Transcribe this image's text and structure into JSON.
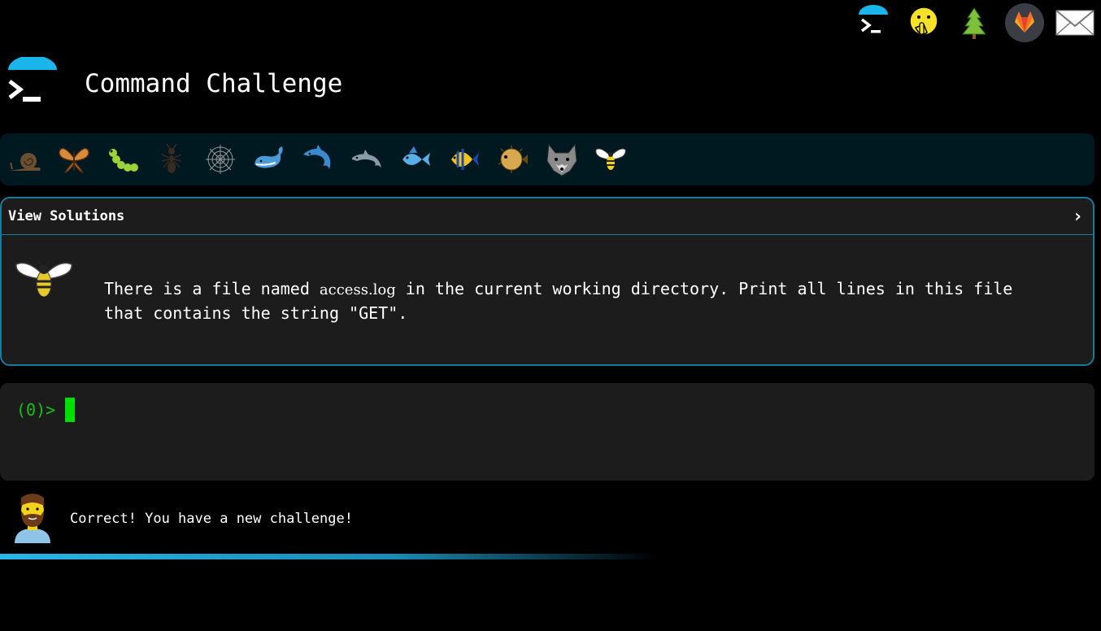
{
  "nav": {
    "icons": [
      "terminal-logo-icon",
      "face-with-hand-over-mouth-icon",
      "tree-icon",
      "gitlab-icon",
      "envelope-icon"
    ]
  },
  "header": {
    "title": "Command Challenge"
  },
  "animals": [
    "snail-icon",
    "butterfly-icon",
    "caterpillar-icon",
    "ant-icon",
    "spider-web-icon",
    "whale-icon",
    "dolphin-icon",
    "dolphin-icon",
    "fish-icon",
    "tropical-fish-icon",
    "blowfish-icon",
    "wolf-icon",
    "bee-icon"
  ],
  "challenge": {
    "view_solutions": "View Solutions",
    "text_before": "There is a file named ",
    "filename": "access.log",
    "text_after": " in the current working directory. Print all lines in this file that contains the string \"GET\"."
  },
  "terminal": {
    "prompt": "(0)>"
  },
  "feedback": {
    "message": "Correct! You have a new challenge!"
  },
  "colors": {
    "accent": "#1a7a99",
    "prompt": "#18c018",
    "cursor": "#00e000",
    "progress": "#29b6e8"
  }
}
